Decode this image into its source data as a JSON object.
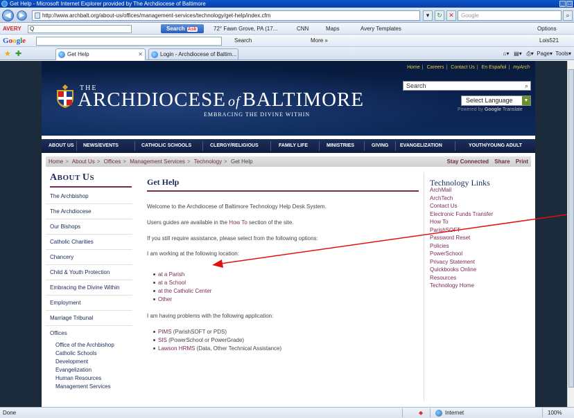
{
  "browser": {
    "window_title": "Get Help - Microsoft Internet Explorer provided by The Archdiocese of Baltimore",
    "url": "http://www.archbalt.org/about-us/offices/management-services/technology/get-help/index.cfm",
    "search_placeholder": "Google",
    "toolbar1": {
      "avery_label": "AVERY",
      "avery_input": "Q",
      "search_button": "Search",
      "search_badge": "Ask",
      "weather": "72° Fawn Grove, PA (17...",
      "cnn": "CNN",
      "maps": "Maps",
      "avery_templates": "Avery Templates",
      "options": "Options"
    },
    "toolbar2": {
      "google_logo": "Google",
      "search": "Search",
      "more": "More »",
      "user": "Lois521"
    },
    "tabs": [
      {
        "label": "Get Help"
      },
      {
        "label": "Login - Archdiocese of Baltim..."
      }
    ],
    "command_bar": {
      "page": "Page",
      "tools": "Tools"
    },
    "status": {
      "text": "Done",
      "zone": "Internet",
      "zoom": "100%"
    }
  },
  "site": {
    "top_links": [
      "Home",
      "Careers",
      "Contact Us",
      "En Español",
      "myArch"
    ],
    "search_label": "Search",
    "language_select": "Select Language",
    "powered_by": "Powered by",
    "google_word": "Google",
    "translate": "Translate",
    "logo": {
      "the": "THE",
      "archdiocese": "ARCHDIOCESE",
      "of": "of",
      "baltimore": "BALTIMORE",
      "tagline": "EMBRACING THE DIVINE WITHIN"
    },
    "main_nav": [
      "ABOUT US",
      "NEWS/EVENTS",
      "CATHOLIC SCHOOLS",
      "CLERGY/RELIGIOUS",
      "FAMILY LIFE",
      "MINISTRIES",
      "GIVING",
      "EVANGELIZATION",
      "YOUTH/YOUNG ADULT"
    ],
    "breadcrumb": [
      "Home",
      "About Us",
      "Offices",
      "Management Services",
      "Technology",
      "Get Help"
    ],
    "crumb_right": [
      "Stay Connected",
      "Share",
      "Print"
    ],
    "left_title_big": "A",
    "left_title_rest": "BOUT ",
    "left_title_big2": "U",
    "left_title_rest2": "S",
    "left_nav": [
      "The Archbishop",
      "The Archdiocese",
      "Our Bishops",
      "Catholic Charities",
      "Chancery",
      "Child & Youth Protection",
      "Embracing the Divine Within",
      "Employment",
      "Marriage Tribunal",
      "Offices"
    ],
    "left_subnav": [
      "Office of the Archbishop",
      "Catholic Schools",
      "Development",
      "Evangelization",
      "Human Resources",
      "Management Services"
    ],
    "main": {
      "title": "Get Help",
      "welcome": "Welcome to the Archdiocese of Baltimore Technology Help Desk System.",
      "guides_pre": "Users guides are available in the ",
      "guides_link": "How To",
      "guides_post": " section of the site.",
      "assist": "If you still require assistance, please select from the following options:",
      "location_intro": "I am working at the following location:",
      "locations": [
        "at a Parish",
        "at a School",
        "at the Catholic Center",
        "Other"
      ],
      "app_intro": "I am having problems with the following application:",
      "apps": [
        {
          "link": "PIMS",
          "desc": " (ParishSOFT or PDS)"
        },
        {
          "link": "SIS",
          "desc": " (PowerSchool or PowerGrade)"
        },
        {
          "link": "Lawson HRMS",
          "desc": " (Data, Other Technical Assistance)"
        }
      ]
    },
    "right_title": "Technology Links",
    "right_links": [
      "ArchMail",
      "ArchTech",
      "Contact Us",
      "Electronic Funds Transfer",
      "How To",
      "ParishSOFT",
      "Password Reset",
      "Policies",
      "PowerSchool",
      "Privacy Statement",
      "Quickbooks Online",
      "Resources",
      "Technology Home"
    ]
  },
  "colors": {
    "annotation_arrow": "#e01010",
    "link": "#7a2a5a",
    "header_navy": "#0a2250",
    "accent_gold": "#e8c84a"
  }
}
